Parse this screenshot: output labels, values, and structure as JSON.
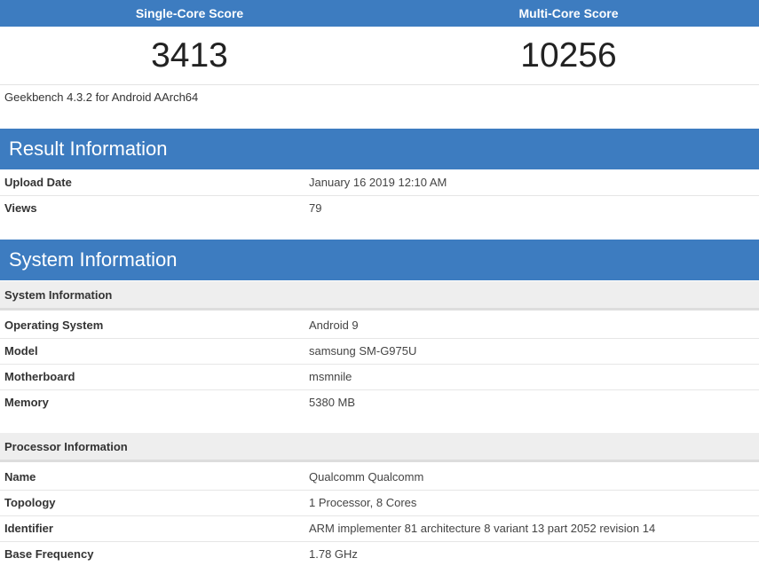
{
  "scores": {
    "single_label": "Single-Core Score",
    "multi_label": "Multi-Core Score",
    "single_value": "3413",
    "multi_value": "10256"
  },
  "version": "Geekbench 4.3.2 for Android AArch64",
  "result_info": {
    "title": "Result Information",
    "rows": [
      {
        "key": "Upload Date",
        "value": "January 16 2019 12:10 AM"
      },
      {
        "key": "Views",
        "value": "79"
      }
    ]
  },
  "system_info": {
    "title": "System Information",
    "system_sub": {
      "title": "System Information",
      "rows": [
        {
          "key": "Operating System",
          "value": "Android 9"
        },
        {
          "key": "Model",
          "value": "samsung SM-G975U"
        },
        {
          "key": "Motherboard",
          "value": "msmnile"
        },
        {
          "key": "Memory",
          "value": "5380 MB"
        }
      ]
    },
    "processor_sub": {
      "title": "Processor Information",
      "rows": [
        {
          "key": "Name",
          "value": "Qualcomm Qualcomm"
        },
        {
          "key": "Topology",
          "value": "1 Processor, 8 Cores"
        },
        {
          "key": "Identifier",
          "value": "ARM implementer 81 architecture 8 variant 13 part 2052 revision 14"
        },
        {
          "key": "Base Frequency",
          "value": "1.78 GHz"
        }
      ]
    }
  },
  "colors": {
    "header_blue": "#3d7cc0",
    "subheader_gray": "#eeeeee"
  }
}
